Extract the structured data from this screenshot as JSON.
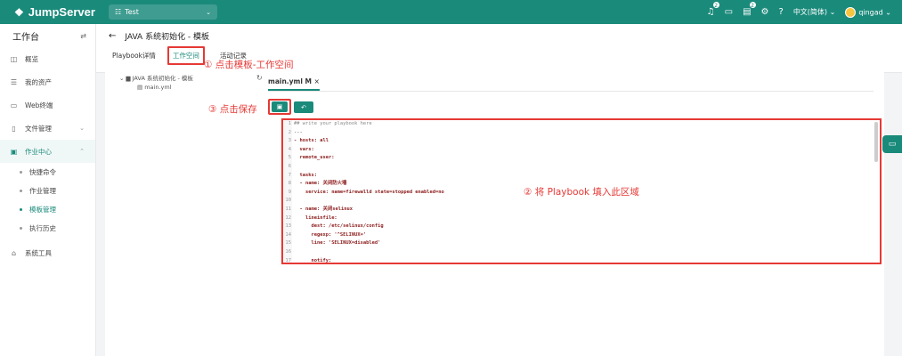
{
  "topbar": {
    "logo_text": "JumpServer",
    "org_label": "Test",
    "notify_count": "2",
    "ticket_count": "2",
    "lang_label": "中文(简体)",
    "user_name": "qingad"
  },
  "sidebar": {
    "title": "工作台",
    "items": [
      {
        "label": "概览"
      },
      {
        "label": "我的资产"
      },
      {
        "label": "Web终端"
      },
      {
        "label": "文件管理"
      },
      {
        "label": "作业中心"
      }
    ],
    "sub_items": [
      {
        "label": "快捷命令"
      },
      {
        "label": "作业管理"
      },
      {
        "label": "模板管理"
      },
      {
        "label": "执行历史"
      }
    ],
    "tools_label": "系统工具"
  },
  "page": {
    "title": "JAVA 系统初始化 - 模板",
    "tabs": [
      "Playbook详情",
      "工作空间",
      "活动记录"
    ]
  },
  "tree": {
    "root": "JAVA 系统初始化 - 模板",
    "file": "main.yml"
  },
  "editor": {
    "file_tab": "main.yml M",
    "lines": [
      "## write your playbook here",
      "---",
      "- hosts: all",
      "  vars:",
      "  remote_user:",
      "",
      "  tasks:",
      "  - name: 关闭防火墙",
      "    service: name=firewalld state=stopped enabled=no",
      "",
      "  - name: 关闭selinux",
      "    lineinfile:",
      "      dest: /etc/selinux/config",
      "      regexp: '^SELINUX='",
      "      line: 'SELINUX=disabled'",
      "",
      "      notify:"
    ]
  },
  "annotations": {
    "a1": "① 点击模板-工作空间",
    "a2": "② 将 Playbook 填入此区域",
    "a3": "③ 点击保存"
  },
  "colors": {
    "brand": "#1a8a7b",
    "annotation": "#e53935"
  }
}
